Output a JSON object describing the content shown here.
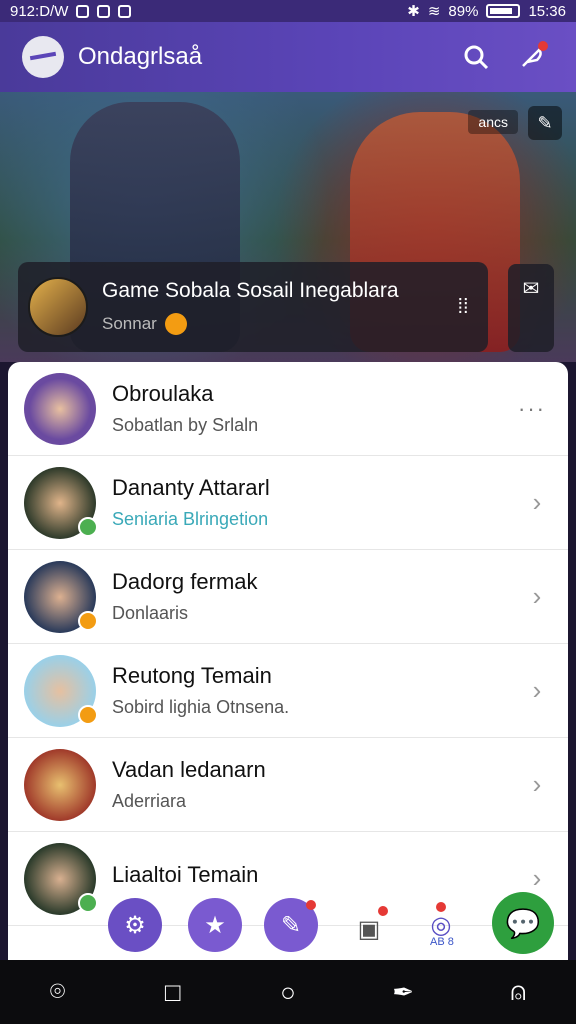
{
  "status": {
    "left": "912:D/W",
    "battery": "89%",
    "time": "15:36"
  },
  "appbar": {
    "title": "Ondagrlsaå",
    "search_icon": "search-icon",
    "feather_icon": "feather-icon"
  },
  "banner": {
    "chip": "ancs",
    "edit_icon": "edit-icon"
  },
  "group": {
    "name": "Game Sobala Sosail Inegablara",
    "subtitle": "Sonnar",
    "grid_icon": "grid-icon",
    "side_icon": "compose-icon"
  },
  "list": [
    {
      "name": "Obroulaka",
      "subtitle": "Sobatlan by Srlaln",
      "accent": "more"
    },
    {
      "name": "Dananty Attararl",
      "subtitle": "Seniaria Blringetion",
      "accent": "chevron"
    },
    {
      "name": "Dadorg fermak",
      "subtitle": "Donlaaris",
      "accent": "chevron"
    },
    {
      "name": "Reutong Temain",
      "subtitle": "Sobird lighia Otnsena.",
      "accent": "chevron"
    },
    {
      "name": "Vadan ledanarn",
      "subtitle": "Aderriara",
      "accent": "chevron"
    },
    {
      "name": "Liaaltoi Temain",
      "subtitle": "",
      "accent": "chevron"
    }
  ],
  "bottom": {
    "mini_label": "AB 8"
  }
}
